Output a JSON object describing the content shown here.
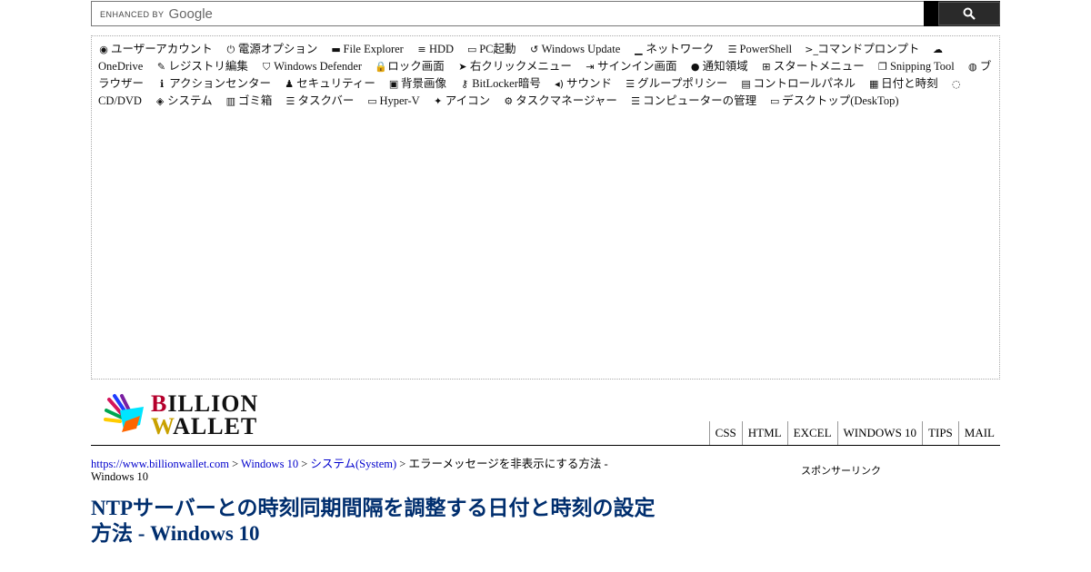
{
  "search": {
    "enhanced_by": "ENHANCED BY",
    "google": "Google",
    "value": ""
  },
  "tags": [
    {
      "label": "ユーザーアカウント",
      "icon": "user-circle-icon",
      "glyph": "◉"
    },
    {
      "label": "電源オプション",
      "icon": "power-icon",
      "glyph": "⏻"
    },
    {
      "label": "File Explorer",
      "icon": "folder-open-icon",
      "glyph": "▬"
    },
    {
      "label": "HDD",
      "icon": "database-icon",
      "glyph": "≡"
    },
    {
      "label": "PC起動",
      "icon": "laptop-icon",
      "glyph": "▭"
    },
    {
      "label": "Windows Update",
      "icon": "history-icon",
      "glyph": "↺"
    },
    {
      "label": "ネットワーク",
      "icon": "signal-icon",
      "glyph": "▁"
    },
    {
      "label": "PowerShell",
      "icon": "list-alt-icon",
      "glyph": "☰"
    },
    {
      "label": "コマンドプロンプト",
      "icon": "terminal-icon",
      "glyph": ">_"
    },
    {
      "label": "OneDrive",
      "icon": "cloud-icon",
      "glyph": "☁"
    },
    {
      "label": "レジストリ編集",
      "icon": "edit-icon",
      "glyph": "✎"
    },
    {
      "label": "Windows Defender",
      "icon": "shield-icon",
      "glyph": "⛉"
    },
    {
      "label": "ロック画面",
      "icon": "lock-icon",
      "glyph": "🔒"
    },
    {
      "label": "右クリックメニュー",
      "icon": "mouse-pointer-icon",
      "glyph": "➤"
    },
    {
      "label": "サインイン画面",
      "icon": "sign-in-icon",
      "glyph": "⇥"
    },
    {
      "label": "通知領域",
      "icon": "comment-icon",
      "glyph": "●"
    },
    {
      "label": "スタートメニュー",
      "icon": "windows-icon",
      "glyph": "⊞"
    },
    {
      "label": "Snipping Tool",
      "icon": "copy-icon",
      "glyph": "❐"
    },
    {
      "label": "ブラウザー",
      "icon": "globe-icon",
      "glyph": "◍"
    },
    {
      "label": "アクションセンター",
      "icon": "info-circle-icon",
      "glyph": "ℹ"
    },
    {
      "label": "セキュリティー",
      "icon": "user-secret-icon",
      "glyph": "♟"
    },
    {
      "label": "背景画像",
      "icon": "picture-icon",
      "glyph": "▣"
    },
    {
      "label": "BitLocker暗号",
      "icon": "key-icon",
      "glyph": "⚷"
    },
    {
      "label": "サウンド",
      "icon": "volume-icon",
      "glyph": "◂)"
    },
    {
      "label": "グループポリシー",
      "icon": "indent-icon",
      "glyph": "☰"
    },
    {
      "label": "コントロールパネル",
      "icon": "id-card-icon",
      "glyph": "▤"
    },
    {
      "label": "日付と時刻",
      "icon": "calendar-icon",
      "glyph": "▦"
    },
    {
      "label": "CD/DVD",
      "icon": "spinner-icon",
      "glyph": "◌"
    },
    {
      "label": "システム",
      "icon": "cube-icon",
      "glyph": "◈"
    },
    {
      "label": "ゴミ箱",
      "icon": "trash-icon",
      "glyph": "▥"
    },
    {
      "label": "タスクバー",
      "icon": "tasks-icon",
      "glyph": "☰"
    },
    {
      "label": "Hyper-V",
      "icon": "desktop-icon",
      "glyph": "▭"
    },
    {
      "label": "アイコン",
      "icon": "magic-icon",
      "glyph": "✦"
    },
    {
      "label": "タスクマネージャー",
      "icon": "cogs-icon",
      "glyph": "⚙"
    },
    {
      "label": "コンピューターの管理",
      "icon": "server-icon",
      "glyph": "☰"
    },
    {
      "label": "デスクトップ(DeskTop)",
      "icon": "desktop-icon",
      "glyph": "▭"
    }
  ],
  "logo": {
    "line1_first": "B",
    "line1_rest": "ILLION",
    "line2_first": "W",
    "line2_rest": "ALLET"
  },
  "nav": [
    "CSS",
    "HTML",
    "EXCEL",
    "WINDOWS 10",
    "TIPS",
    "MAIL"
  ],
  "breadcrumb": {
    "home": "https://www.billionwallet.com",
    "sep": " > ",
    "section": "Windows 10",
    "category": "システム(System)",
    "current": "エラーメッセージを非表示にする方法 - Windows 10"
  },
  "sponsor": "スポンサーリンク",
  "title": "NTPサーバーとの時刻同期間隔を調整する日付と時刻の設定方法 - Windows 10"
}
